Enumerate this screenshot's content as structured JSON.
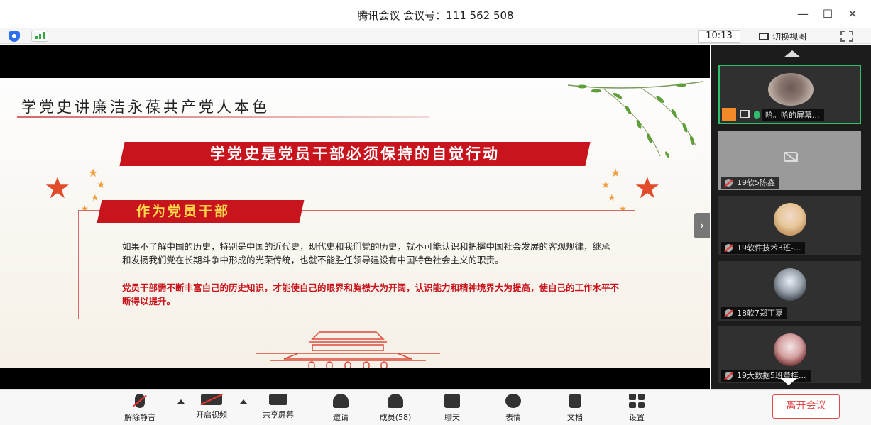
{
  "window": {
    "title": "腾讯会议 会议号：111 562 508",
    "minimize": "—",
    "maximize": "☐",
    "close": "✕"
  },
  "topbar": {
    "time": "10:13",
    "switch_view": "切换视图"
  },
  "slide": {
    "title": "学党史讲廉洁永葆共产党人本色",
    "banner": "学党史是党员干部必须保持的自觉行动",
    "section_label": "作为党员干部",
    "paragraph": "如果不了解中国的历史，特别是中国的近代史，现代史和我们党的历史，就不可能认识和把握中国社会发展的客观规律，继承和发扬我们党在长期斗争中形成的光荣传统，也就不能胜任领导建设有中国特色社会主义的职责。",
    "emphasis": "党员干部需不断丰富自己的历史知识，才能使自己的眼界和胸襟大为开阔，认识能力和精神境界大为提高，使自己的工作水平不断得以提升。"
  },
  "participants": [
    {
      "name": "哈。哈的屏幕..."
    },
    {
      "name": "19软5陈鑫"
    },
    {
      "name": "19软件技术3班-..."
    },
    {
      "name": "18软7郑丁嘉"
    },
    {
      "name": "19大数据5班黄桂..."
    }
  ],
  "toolbar": {
    "unmute": "解除静音",
    "start_video": "开启视频",
    "share_screen": "共享屏幕",
    "invite": "邀请",
    "members": "成员(58)",
    "chat": "聊天",
    "reactions": "表情",
    "docs": "文档",
    "settings": "设置",
    "leave": "离开会议"
  },
  "colors": {
    "accent_red": "#c8141c",
    "leave_red": "#e04a4a",
    "active_green": "#2fbf6c"
  }
}
